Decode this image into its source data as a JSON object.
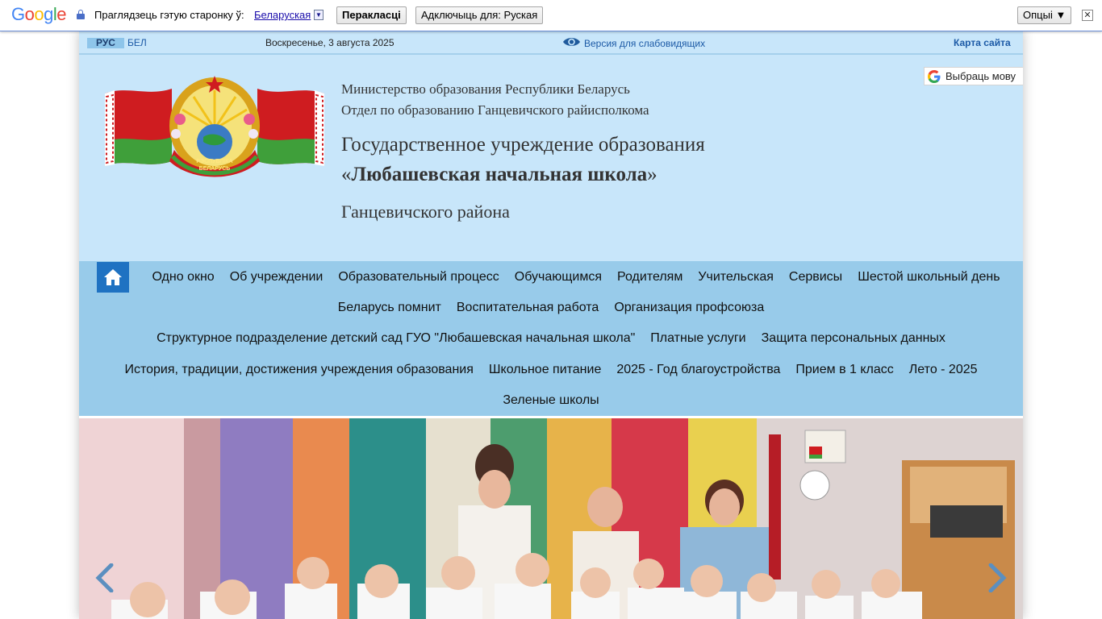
{
  "translate_bar": {
    "logo": "Google",
    "prompt": "Праглядзець гэтую старонку ў:",
    "language": "Беларуская",
    "translate_button": "Перакласці",
    "disable_button": "Адключыць для: Руская",
    "options_button": "Опцыі ▼",
    "close_symbol": "✕"
  },
  "topbar": {
    "lang_ru": "РУС",
    "lang_be": "БЕЛ",
    "date": "Воскресенье, 3 августа 2025",
    "vision_link": "Версия для слабовидящих",
    "sitemap": "Карта сайта"
  },
  "header": {
    "ministry_line1": "Министерство образования Республики Беларусь",
    "ministry_line2": "Отдел по образованию Ганцевичского райисполкома",
    "org_line1": "Государственное учреждение образования",
    "quote_open": "«",
    "org_name": "Любашевская начальная школа",
    "quote_close": "»",
    "district": "Ганцевичского района",
    "emblem_text1": "РЭСПУБЛІКА",
    "emblem_text2": "БЕЛАРУСЬ",
    "translate_widget": "Выбраць мову"
  },
  "nav": {
    "row1": [
      "Одно окно",
      "Об учреждении",
      "Образовательный процесс",
      "Обучающимся",
      "Родителям",
      "Учительская",
      "Сервисы",
      "Шестой школьный день"
    ],
    "row2": [
      "Беларусь помнит",
      "Воспитательная работа",
      "Организация профсоюза"
    ],
    "row3": [
      "Структурное подразделение детский сад ГУО \"Любашевская начальная школа\"",
      "Платные услуги",
      "Защита персональных данных"
    ],
    "row4": [
      "История, традиции, достижения учреждения образования",
      "Школьное питание",
      "2025 - Год благоустройства",
      "Прием в 1 класс",
      "Лето - 2025"
    ],
    "row5": [
      "Зеленые школы"
    ]
  },
  "icons": {
    "home": "home-icon",
    "eye": "eye-icon",
    "lock": "lock-icon",
    "prev": "chevron-left-icon",
    "next": "chevron-right-icon"
  },
  "colors": {
    "page_bg": "#c8e6fa",
    "nav_bg": "#98cbea",
    "home_bg": "#1f72c2",
    "link": "#1c5aa6"
  }
}
